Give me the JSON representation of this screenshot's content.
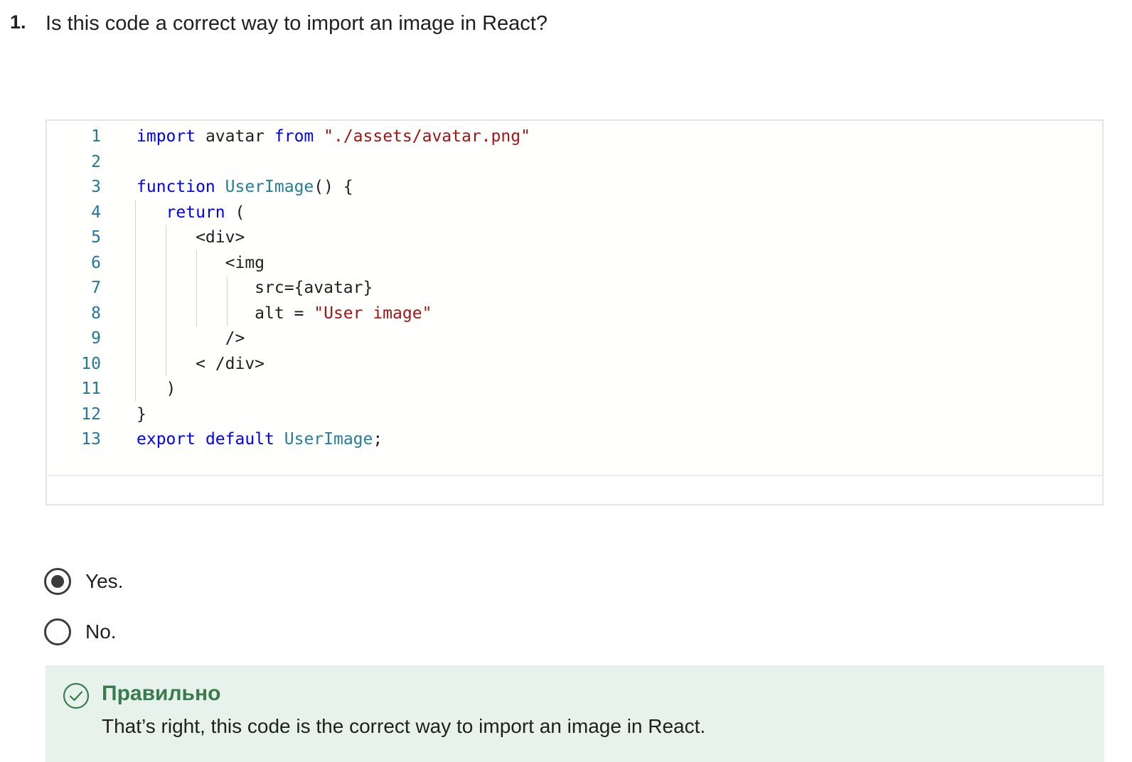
{
  "question": {
    "number": "1.",
    "text": "Is this code a correct way to import an image in React?"
  },
  "code": {
    "lines": [
      {
        "num": "1",
        "tokens": [
          {
            "t": "kw",
            "v": "import"
          },
          {
            "t": "plain",
            "v": " avatar "
          },
          {
            "t": "kw",
            "v": "from"
          },
          {
            "t": "plain",
            "v": " "
          },
          {
            "t": "str",
            "v": "\"./assets/avatar.png\""
          }
        ]
      },
      {
        "num": "2",
        "tokens": []
      },
      {
        "num": "3",
        "tokens": [
          {
            "t": "kw",
            "v": "function"
          },
          {
            "t": "plain",
            "v": " "
          },
          {
            "t": "type",
            "v": "UserImage"
          },
          {
            "t": "plain",
            "v": "() {"
          }
        ]
      },
      {
        "num": "4",
        "tokens": [
          {
            "t": "plain",
            "v": "   "
          },
          {
            "t": "kw",
            "v": "return"
          },
          {
            "t": "plain",
            "v": " ("
          }
        ]
      },
      {
        "num": "5",
        "tokens": [
          {
            "t": "plain",
            "v": "      <div>"
          }
        ]
      },
      {
        "num": "6",
        "tokens": [
          {
            "t": "plain",
            "v": "         <img"
          }
        ]
      },
      {
        "num": "7",
        "tokens": [
          {
            "t": "plain",
            "v": "            src={avatar}"
          }
        ]
      },
      {
        "num": "8",
        "tokens": [
          {
            "t": "plain",
            "v": "            alt = "
          },
          {
            "t": "str",
            "v": "\"User image\""
          }
        ]
      },
      {
        "num": "9",
        "tokens": [
          {
            "t": "plain",
            "v": "         />"
          }
        ]
      },
      {
        "num": "10",
        "tokens": [
          {
            "t": "plain",
            "v": "      < /div>"
          }
        ]
      },
      {
        "num": "11",
        "tokens": [
          {
            "t": "plain",
            "v": "   )"
          }
        ]
      },
      {
        "num": "12",
        "tokens": [
          {
            "t": "plain",
            "v": "}"
          }
        ]
      },
      {
        "num": "13",
        "tokens": [
          {
            "t": "kw",
            "v": "export"
          },
          {
            "t": "plain",
            "v": " "
          },
          {
            "t": "kw",
            "v": "default"
          },
          {
            "t": "plain",
            "v": " "
          },
          {
            "t": "type",
            "v": "UserImage"
          },
          {
            "t": "plain",
            "v": ";"
          }
        ]
      }
    ]
  },
  "options": [
    {
      "label": "Yes.",
      "selected": true
    },
    {
      "label": "No.",
      "selected": false
    }
  ],
  "feedback": {
    "title": "Правильно",
    "text": "That’s right, this code is the correct way to import an image in React.",
    "icon": "check-circle-icon",
    "accent_color": "#3a7b4e",
    "background_color": "#e8f2ec"
  }
}
